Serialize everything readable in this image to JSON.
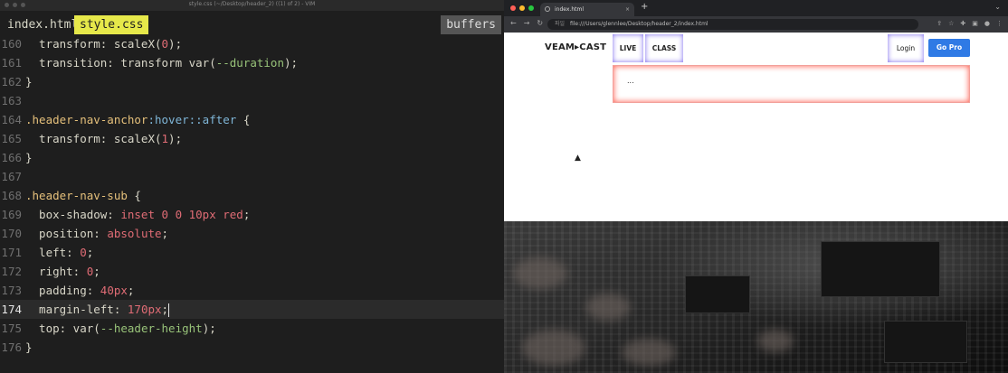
{
  "editor": {
    "window_title": "style.css (~/Desktop/header_2) ((1) of 2) - VIM",
    "tabs": [
      "index.html",
      "style.css"
    ],
    "buffers_label": "buffers",
    "lines": [
      {
        "n": "160",
        "text": "  transform: scaleX(0);"
      },
      {
        "n": "161",
        "text": "  transition: transform var(--duration);"
      },
      {
        "n": "162",
        "text": "}"
      },
      {
        "n": "163",
        "text": ""
      },
      {
        "n": "164",
        "text": ".header-nav-anchor:hover::after {"
      },
      {
        "n": "165",
        "text": "  transform: scaleX(1);"
      },
      {
        "n": "166",
        "text": "}"
      },
      {
        "n": "167",
        "text": ""
      },
      {
        "n": "168",
        "text": ".header-nav-sub {"
      },
      {
        "n": "169",
        "text": "  box-shadow: inset 0 0 10px red;"
      },
      {
        "n": "170",
        "text": "  position: absolute;"
      },
      {
        "n": "171",
        "text": "  left: 0;"
      },
      {
        "n": "172",
        "text": "  right: 0;"
      },
      {
        "n": "173",
        "text": "  padding: 40px;"
      },
      {
        "n": "174",
        "text": "  margin-left: 170px;"
      },
      {
        "n": "175",
        "text": "  top: var(--header-height);"
      },
      {
        "n": "176",
        "text": "}"
      }
    ],
    "current_line": "174"
  },
  "browser": {
    "tab_title": "index.html",
    "tab_close": "×",
    "new_tab": "+",
    "address_prefix": "파일",
    "url": "file:///Users/glennlee/Desktop/header_2/index.html",
    "page": {
      "logo": "VEAM▸CAST",
      "nav": [
        "LIVE",
        "CLASS"
      ],
      "login": "Login",
      "go_pro": "Go Pro",
      "sub_text": "..."
    }
  }
}
